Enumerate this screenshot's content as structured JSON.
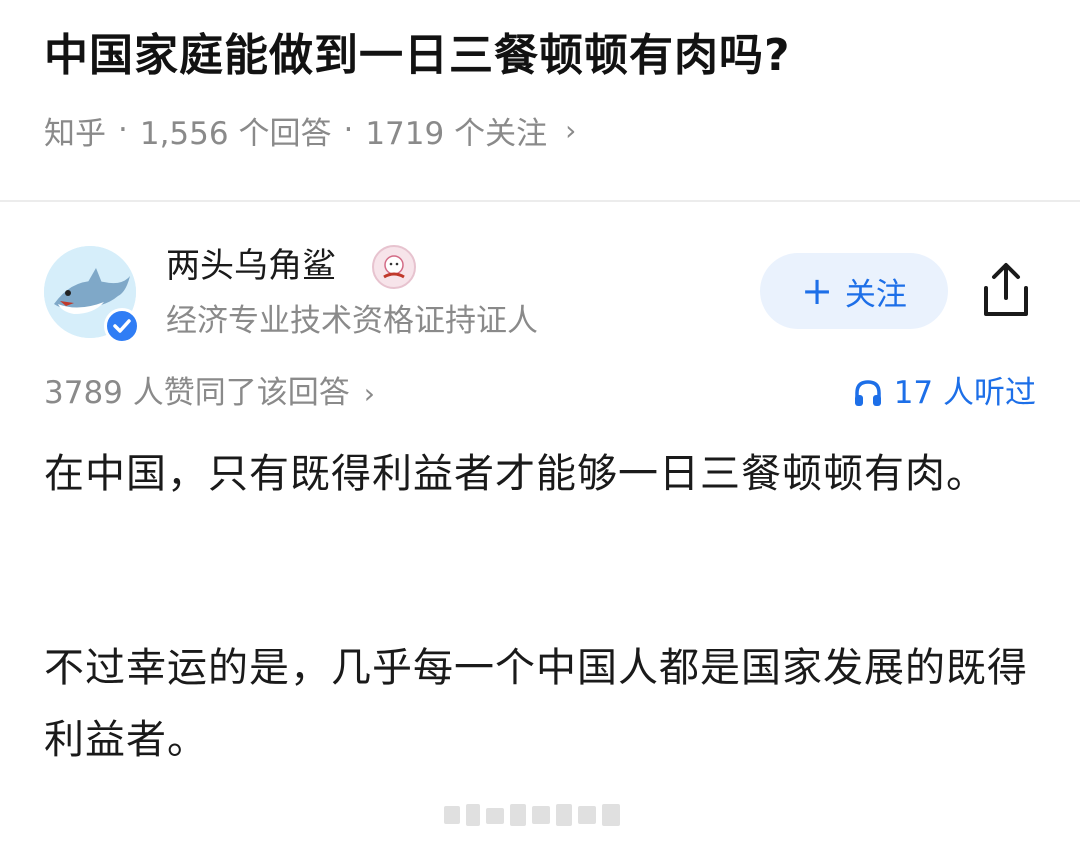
{
  "question": {
    "title": "中国家庭能做到一日三餐顿顿有肉吗?",
    "source": "知乎",
    "answers": "1,556 个回答",
    "followers": "1719 个关注"
  },
  "author": {
    "name": "两头乌角鲨",
    "description": "经济专业技术资格证持证人",
    "follow_label": "关注"
  },
  "answer": {
    "likes": "3789 人赞同了该回答",
    "listens": "17 人听过",
    "paragraphs": [
      "在中国，只有既得利益者才能够一日三餐顿顿有肉。",
      "不过幸运的是，几乎每一个中国人都是国家发展的既得利益者。"
    ]
  },
  "colors": {
    "accent": "#1d6fe8",
    "follow_bg": "#eaf2fd",
    "muted": "#8a8a8a",
    "verified": "#2f7df5"
  }
}
